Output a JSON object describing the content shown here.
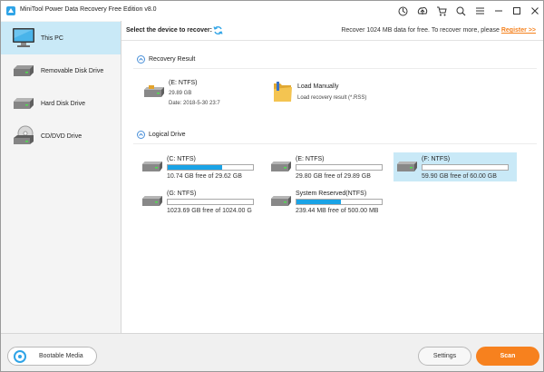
{
  "window": {
    "title": "MiniTool Power Data Recovery Free Edition v8.0"
  },
  "sidebar": {
    "items": [
      {
        "label": "This PC",
        "icon": "monitor-icon",
        "active": true
      },
      {
        "label": "Removable Disk Drive",
        "icon": "removable-drive-icon",
        "active": false
      },
      {
        "label": "Hard Disk Drive",
        "icon": "hard-disk-icon",
        "active": false
      },
      {
        "label": "CD/DVD Drive",
        "icon": "cd-dvd-icon",
        "active": false
      }
    ]
  },
  "toolbar": {
    "select_label": "Select the device to recover:",
    "promo_text": "Recover 1024 MB data for free. To recover more, please ",
    "register_link": "Register >>"
  },
  "recovery_result": {
    "section_label": "Recovery Result",
    "result_name": "(E: NTFS)",
    "result_size": "29.89 GB",
    "result_date": "Date: 2018-5-30 23:7",
    "load_title": "Load Manually",
    "load_desc": "Load recovery result (*.RSS)"
  },
  "logical_drive": {
    "section_label": "Logical Drive",
    "drives": [
      {
        "name": "(C: NTFS)",
        "free": "10.74 GB free of 29.62 GB",
        "used_fraction": 0.64,
        "selected": false
      },
      {
        "name": "(E: NTFS)",
        "free": "29.80 GB free of 29.89 GB",
        "used_fraction": 0.0,
        "selected": false
      },
      {
        "name": "(F: NTFS)",
        "free": "59.90 GB free of 60.00 GB",
        "used_fraction": 0.0,
        "selected": true
      },
      {
        "name": "(G: NTFS)",
        "free": "1023.69 GB free of 1024.00 G",
        "used_fraction": 0.0,
        "selected": false
      },
      {
        "name": "System Reserved(NTFS)",
        "free": "239.44 MB free of 500.00 MB",
        "used_fraction": 0.52,
        "selected": false
      }
    ]
  },
  "bottom": {
    "bootable_label": "Bootable Media",
    "settings_label": "Settings",
    "scan_label": "Scan"
  },
  "colors": {
    "accent": "#1aa3e6",
    "selection": "#c9e9f7",
    "scan_button": "#f7811e",
    "register_link": "#f5821f"
  }
}
